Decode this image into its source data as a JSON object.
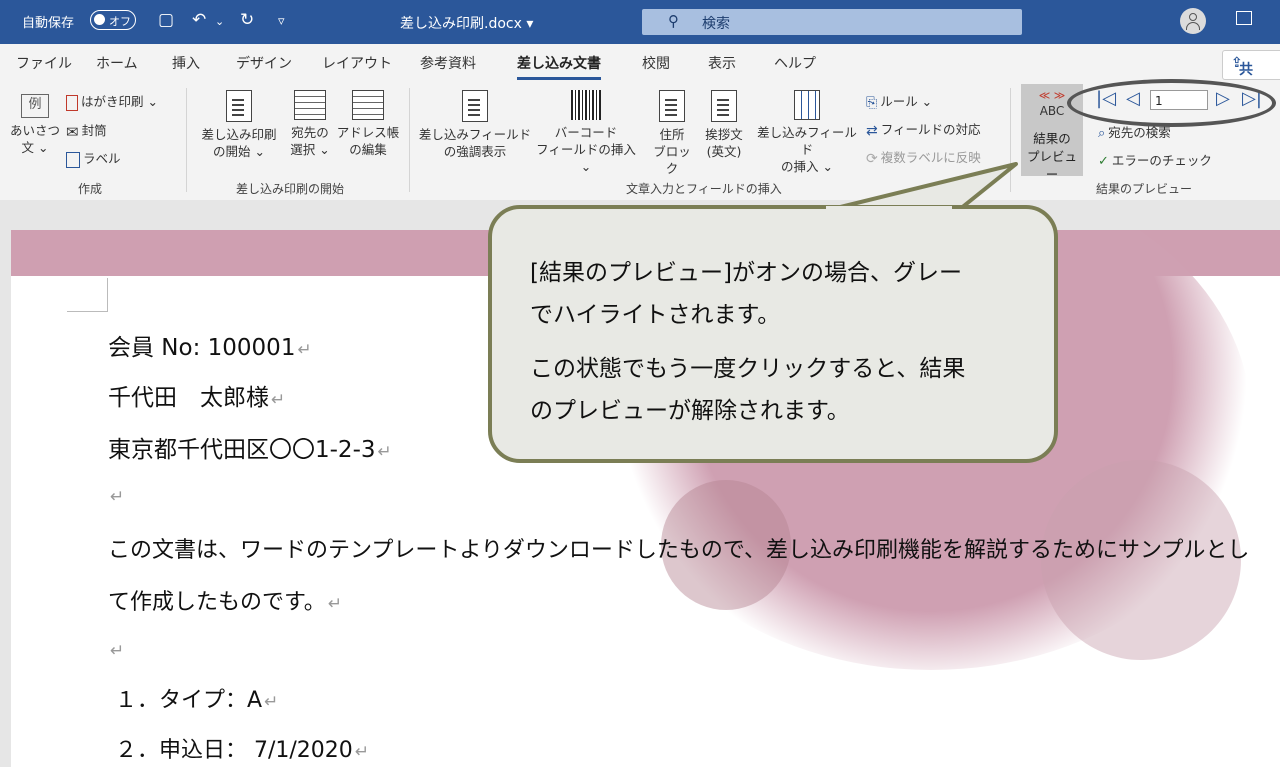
{
  "titlebar": {
    "autosave_label": "自動保存",
    "autosave_state": "オフ",
    "doc_name": "差し込み印刷.docx ▾",
    "search_placeholder": "検索"
  },
  "tabs": [
    "ファイル",
    "ホーム",
    "挿入",
    "デザイン",
    "レイアウト",
    "参考資料",
    "差し込み文書",
    "校閲",
    "表示",
    "ヘルプ"
  ],
  "active_tab": "差し込み文書",
  "share_label": "共有",
  "ribbon": {
    "create": {
      "example_icon": "例",
      "envelope_label_l1": "あいさつ",
      "envelope_label_l2": "文 ⌄",
      "postcard": "はがき印刷 ⌄",
      "envelope": "封筒",
      "label": "ラベル",
      "group": "作成"
    },
    "start": {
      "start_l1": "差し込み印刷",
      "start_l2": "の開始 ⌄",
      "select_l1": "宛先の",
      "select_l2": "選択 ⌄",
      "edit_l1": "アドレス帳",
      "edit_l2": "の編集",
      "group": "差し込み印刷の開始"
    },
    "fields": {
      "highlight_l1": "差し込みフィールド",
      "highlight_l2": "の強調表示",
      "barcode_l1": "バーコード",
      "barcode_l2": "フィールドの挿入 ⌄",
      "address_l1": "住所",
      "address_l2": "ブロック",
      "greeting_l1": "挨拶文",
      "greeting_l2": "(英文)",
      "insert_l1": "差し込みフィールド",
      "insert_l2": "の挿入 ⌄",
      "rules": "ルール ⌄",
      "match": "フィールドの対応",
      "update": "複数ラベルに反映",
      "group": "文章入力とフィールドの挿入"
    },
    "preview": {
      "abc_top": "≪ ≫",
      "abc": "ABC",
      "button_l1": "結果の",
      "button_l2": "プレビュー",
      "record_value": "1",
      "find": "宛先の検索",
      "check": "エラーのチェック",
      "group": "結果のプレビュー"
    }
  },
  "document": {
    "member": "会員 No: 100001",
    "name": "千代田　太郎様",
    "address": "東京都千代田区〇〇1-2-3",
    "body_l1": "この文書は、ワードのテンプレートよりダウンロードしたもので、差し込み印刷機能を解説するためにサンプルとし",
    "body_l2": "て作成したものです。",
    "item1": "１．タイプ：A",
    "item2": "２．申込日： 7/1/2020",
    "para_mark": "↵"
  },
  "callout": {
    "line1": "[結果のプレビュー]がオンの場合、グレー",
    "line2": "でハイライトされます。",
    "line3": "この状態でもう一度クリックすると、結果",
    "line4": "のプレビューが解除されます。"
  },
  "colors": {
    "titlebar": "#2b579a",
    "accent_pink": "#cf9fb1",
    "callout_border": "#7b7e55",
    "callout_bg": "#e8e9e4",
    "highlight_gray": "#c8c8c8"
  }
}
